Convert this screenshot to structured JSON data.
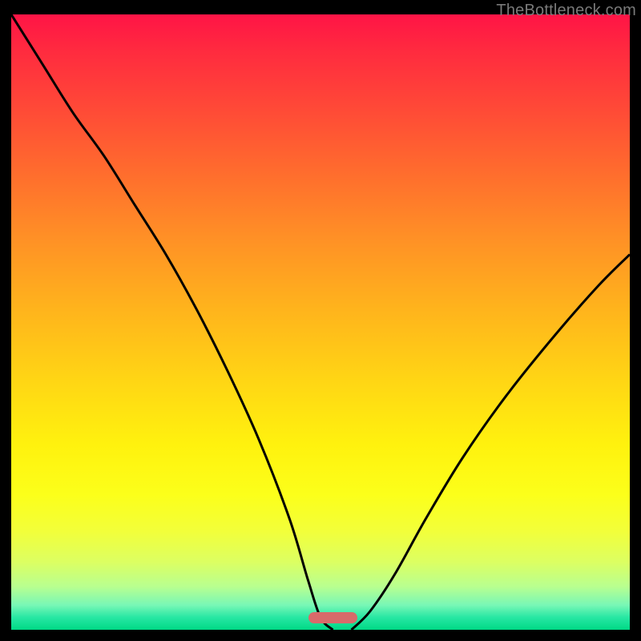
{
  "watermark": "TheBottleneck.com",
  "colors": {
    "frame_bg": "#000000",
    "gradient_top": "#ff1446",
    "gradient_bottom": "#00d985",
    "marker": "#d86a6a",
    "curve": "#000000",
    "watermark_text": "#7a7a7a"
  },
  "chart_data": {
    "type": "line",
    "title": "",
    "xlabel": "",
    "ylabel": "",
    "xlim": [
      0,
      100
    ],
    "ylim": [
      0,
      100
    ],
    "grid": false,
    "legend": false,
    "series": [
      {
        "name": "left-curve",
        "x": [
          0,
          5,
          10,
          15,
          20,
          25,
          30,
          35,
          40,
          45,
          48,
          50,
          52
        ],
        "values": [
          100,
          92,
          84,
          77,
          69,
          61,
          52,
          42,
          31,
          18,
          8,
          2,
          0
        ]
      },
      {
        "name": "right-curve",
        "x": [
          55,
          58,
          62,
          67,
          73,
          80,
          88,
          95,
          100
        ],
        "values": [
          0,
          3,
          9,
          18,
          28,
          38,
          48,
          56,
          61
        ]
      }
    ],
    "background_gradient": {
      "direction": "vertical",
      "stops": [
        {
          "pos": 0.0,
          "color": "#ff1446"
        },
        {
          "pos": 0.25,
          "color": "#ff6a2e"
        },
        {
          "pos": 0.5,
          "color": "#ffc018"
        },
        {
          "pos": 0.7,
          "color": "#fff20e"
        },
        {
          "pos": 0.9,
          "color": "#c8ff7a"
        },
        {
          "pos": 1.0,
          "color": "#00d985"
        }
      ]
    },
    "marker": {
      "x_range": [
        48,
        56
      ],
      "y": 2,
      "color": "#d86a6a",
      "shape": "rounded-bar"
    }
  }
}
